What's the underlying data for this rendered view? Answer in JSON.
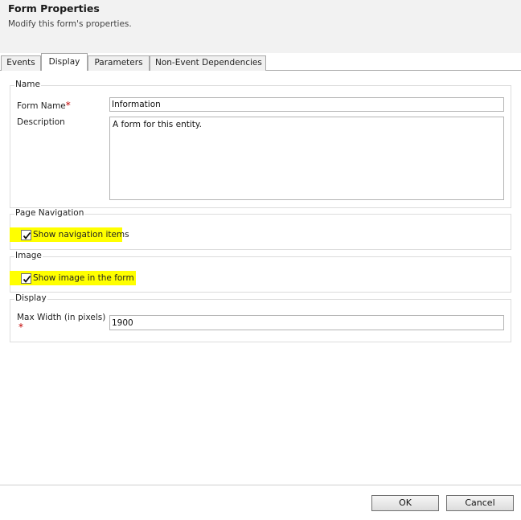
{
  "header": {
    "title": "Form Properties",
    "subtitle": "Modify this form's properties."
  },
  "tabs": [
    {
      "label": "Events",
      "active": false
    },
    {
      "label": "Display",
      "active": true
    },
    {
      "label": "Parameters",
      "active": false
    },
    {
      "label": "Non-Event Dependencies",
      "active": false
    }
  ],
  "name_section": {
    "legend": "Name",
    "form_name_label": "Form Name",
    "required_mark": "*",
    "form_name_value": "Information",
    "description_label": "Description",
    "description_value": "A form for this entity."
  },
  "page_navigation": {
    "legend": "Page Navigation",
    "checkbox_label": "Show navigation items",
    "checked": true
  },
  "image_section": {
    "legend": "Image",
    "checkbox_label": "Show image in the form",
    "checked": true
  },
  "display_section": {
    "legend": "Display",
    "max_width_label": "Max Width (in pixels)",
    "required_mark": "*",
    "max_width_value": "1900"
  },
  "footer": {
    "ok_label": "OK",
    "cancel_label": "Cancel"
  },
  "colors": {
    "highlight": "#ffff00",
    "required": "#c00000",
    "header_bg": "#f2f2f2"
  }
}
